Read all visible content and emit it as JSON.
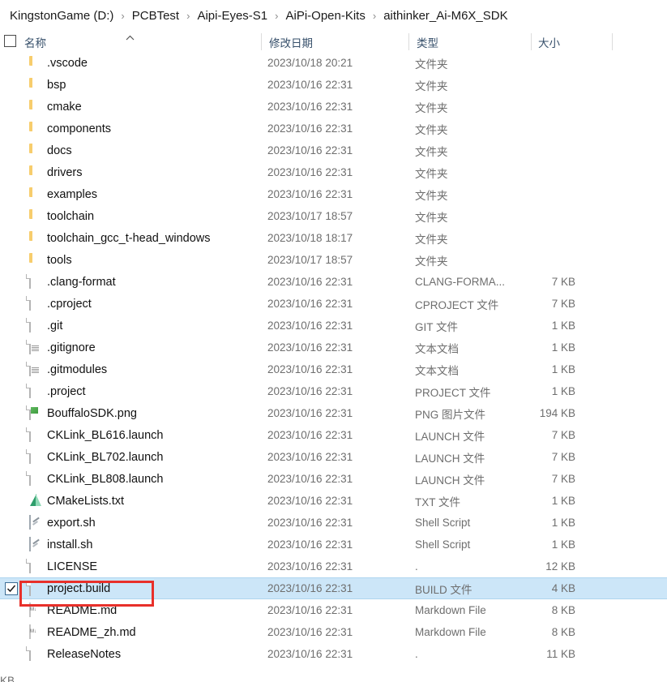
{
  "breadcrumb": {
    "separator": "›",
    "items": [
      {
        "label": "KingstonGame (D:)"
      },
      {
        "label": "PCBTest"
      },
      {
        "label": "Aipi-Eyes-S1"
      },
      {
        "label": "AiPi-Open-Kits"
      },
      {
        "label": "aithinker_Ai-M6X_SDK"
      }
    ]
  },
  "columns": {
    "name": "名称",
    "date_modified": "修改日期",
    "type": "类型",
    "size": "大小",
    "sort_by": "名称",
    "sort_direction": "ascending",
    "select_all_checked": false
  },
  "colors": {
    "selection_bg": "#cce6f8",
    "selection_border": "#aed5ef",
    "annotation": "#e8302a",
    "header_text": "#37506b",
    "secondary_text": "#6e6e6e",
    "folder": "#f3c25c"
  },
  "annotation": {
    "target": "project.build",
    "shape": "rectangle",
    "color": "#e8302a"
  },
  "bottom_clipped_text": "KB",
  "rows": [
    {
      "name": ".vscode",
      "date": "2023/10/18 20:21",
      "type": "文件夹",
      "size": "",
      "icon": "folder-icon",
      "selected": false,
      "checked": false
    },
    {
      "name": "bsp",
      "date": "2023/10/16 22:31",
      "type": "文件夹",
      "size": "",
      "icon": "folder-icon",
      "selected": false,
      "checked": false
    },
    {
      "name": "cmake",
      "date": "2023/10/16 22:31",
      "type": "文件夹",
      "size": "",
      "icon": "folder-icon",
      "selected": false,
      "checked": false
    },
    {
      "name": "components",
      "date": "2023/10/16 22:31",
      "type": "文件夹",
      "size": "",
      "icon": "folder-icon",
      "selected": false,
      "checked": false
    },
    {
      "name": "docs",
      "date": "2023/10/16 22:31",
      "type": "文件夹",
      "size": "",
      "icon": "folder-icon",
      "selected": false,
      "checked": false
    },
    {
      "name": "drivers",
      "date": "2023/10/16 22:31",
      "type": "文件夹",
      "size": "",
      "icon": "folder-icon",
      "selected": false,
      "checked": false
    },
    {
      "name": "examples",
      "date": "2023/10/16 22:31",
      "type": "文件夹",
      "size": "",
      "icon": "folder-icon",
      "selected": false,
      "checked": false
    },
    {
      "name": "toolchain",
      "date": "2023/10/17 18:57",
      "type": "文件夹",
      "size": "",
      "icon": "folder-icon",
      "selected": false,
      "checked": false
    },
    {
      "name": "toolchain_gcc_t-head_windows",
      "date": "2023/10/18 18:17",
      "type": "文件夹",
      "size": "",
      "icon": "folder-icon",
      "selected": false,
      "checked": false
    },
    {
      "name": "tools",
      "date": "2023/10/17 18:57",
      "type": "文件夹",
      "size": "",
      "icon": "folder-icon",
      "selected": false,
      "checked": false
    },
    {
      "name": ".clang-format",
      "date": "2023/10/16 22:31",
      "type": "CLANG-FORMA...",
      "size": "7 KB",
      "icon": "blank-document-icon",
      "selected": false,
      "checked": false
    },
    {
      "name": ".cproject",
      "date": "2023/10/16 22:31",
      "type": "CPROJECT 文件",
      "size": "7 KB",
      "icon": "blank-document-icon",
      "selected": false,
      "checked": false
    },
    {
      "name": ".git",
      "date": "2023/10/16 22:31",
      "type": "GIT 文件",
      "size": "1 KB",
      "icon": "blank-document-icon",
      "selected": false,
      "checked": false
    },
    {
      "name": ".gitignore",
      "date": "2023/10/16 22:31",
      "type": "文本文档",
      "size": "1 KB",
      "icon": "text-document-icon",
      "selected": false,
      "checked": false
    },
    {
      "name": ".gitmodules",
      "date": "2023/10/16 22:31",
      "type": "文本文档",
      "size": "1 KB",
      "icon": "text-document-icon",
      "selected": false,
      "checked": false
    },
    {
      "name": ".project",
      "date": "2023/10/16 22:31",
      "type": "PROJECT 文件",
      "size": "1 KB",
      "icon": "blank-document-icon",
      "selected": false,
      "checked": false
    },
    {
      "name": "BouffaloSDK.png",
      "date": "2023/10/16 22:31",
      "type": "PNG 图片文件",
      "size": "194 KB",
      "icon": "image-file-icon",
      "selected": false,
      "checked": false
    },
    {
      "name": "CKLink_BL616.launch",
      "date": "2023/10/16 22:31",
      "type": "LAUNCH 文件",
      "size": "7 KB",
      "icon": "blank-document-icon",
      "selected": false,
      "checked": false
    },
    {
      "name": "CKLink_BL702.launch",
      "date": "2023/10/16 22:31",
      "type": "LAUNCH 文件",
      "size": "7 KB",
      "icon": "blank-document-icon",
      "selected": false,
      "checked": false
    },
    {
      "name": "CKLink_BL808.launch",
      "date": "2023/10/16 22:31",
      "type": "LAUNCH 文件",
      "size": "7 KB",
      "icon": "blank-document-icon",
      "selected": false,
      "checked": false
    },
    {
      "name": "CMakeLists.txt",
      "date": "2023/10/16 22:31",
      "type": "TXT 文件",
      "size": "1 KB",
      "icon": "cmake-file-icon",
      "selected": false,
      "checked": false
    },
    {
      "name": "export.sh",
      "date": "2023/10/16 22:31",
      "type": "Shell Script",
      "size": "1 KB",
      "icon": "shell-script-icon",
      "selected": false,
      "checked": false
    },
    {
      "name": "install.sh",
      "date": "2023/10/16 22:31",
      "type": "Shell Script",
      "size": "1 KB",
      "icon": "shell-script-icon",
      "selected": false,
      "checked": false
    },
    {
      "name": "LICENSE",
      "date": "2023/10/16 22:31",
      "type": ".",
      "size": "12 KB",
      "icon": "blank-document-icon",
      "selected": false,
      "checked": false
    },
    {
      "name": "project.build",
      "date": "2023/10/16 22:31",
      "type": "BUILD 文件",
      "size": "4 KB",
      "icon": "blank-document-icon",
      "selected": true,
      "checked": true
    },
    {
      "name": "README.md",
      "date": "2023/10/16 22:31",
      "type": "Markdown File",
      "size": "8 KB",
      "icon": "markdown-file-icon",
      "selected": false,
      "checked": false
    },
    {
      "name": "README_zh.md",
      "date": "2023/10/16 22:31",
      "type": "Markdown File",
      "size": "8 KB",
      "icon": "markdown-file-icon",
      "selected": false,
      "checked": false
    },
    {
      "name": "ReleaseNotes",
      "date": "2023/10/16 22:31",
      "type": ".",
      "size": "11 KB",
      "icon": "blank-document-icon",
      "selected": false,
      "checked": false
    }
  ]
}
